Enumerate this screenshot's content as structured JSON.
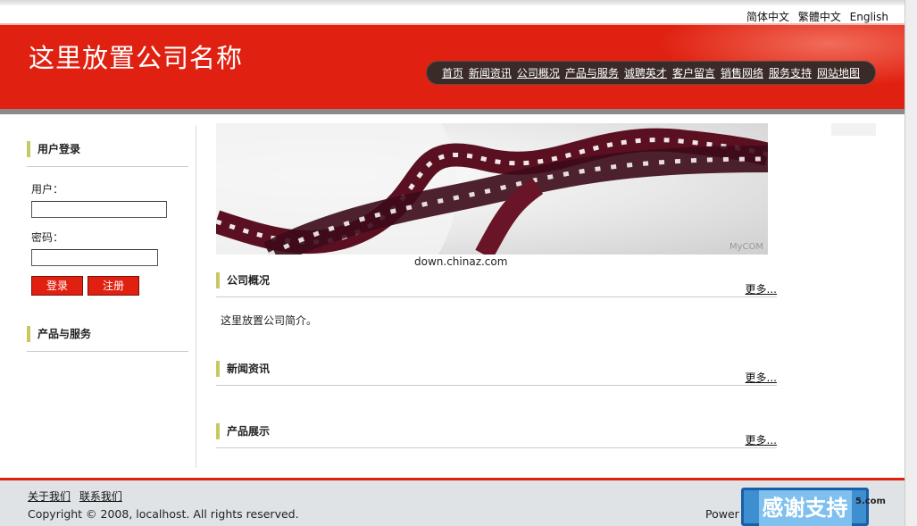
{
  "languages": [
    "简体中文",
    "繁體中文",
    "English"
  ],
  "company_name": "这里放置公司名称",
  "nav": [
    "首页",
    "新闻资讯",
    "公司概况",
    "产品与服务",
    "诚聘英才",
    "客户留言",
    "销售网络",
    "服务支持",
    "网站地图"
  ],
  "login": {
    "title": "用户登录",
    "user_label": "用户：",
    "pass_label": "密码：",
    "login_button": "登录",
    "register_button": "注册"
  },
  "products_services_title": "产品与服务",
  "banner_caption": "down.chinaz.com",
  "banner_watermark": "MyCOM",
  "sections": {
    "about": {
      "title": "公司概况",
      "more": "更多...",
      "text": "这里放置公司简介。"
    },
    "news": {
      "title": "新闻资讯",
      "more": "更多..."
    },
    "products": {
      "title": "产品展示",
      "more": "更多..."
    }
  },
  "footer": {
    "about_link": "关于我们",
    "contact_link": "联系我们",
    "copyright": "Copyright © 2008, localhost. All rights reserved.",
    "powered": "Power",
    "thanks": "感谢支持",
    "watermark": "5.com"
  },
  "colors": {
    "brand_red": "#e02010",
    "accent_yellow": "#c8c860",
    "nav_dark": "#3a2a28"
  }
}
